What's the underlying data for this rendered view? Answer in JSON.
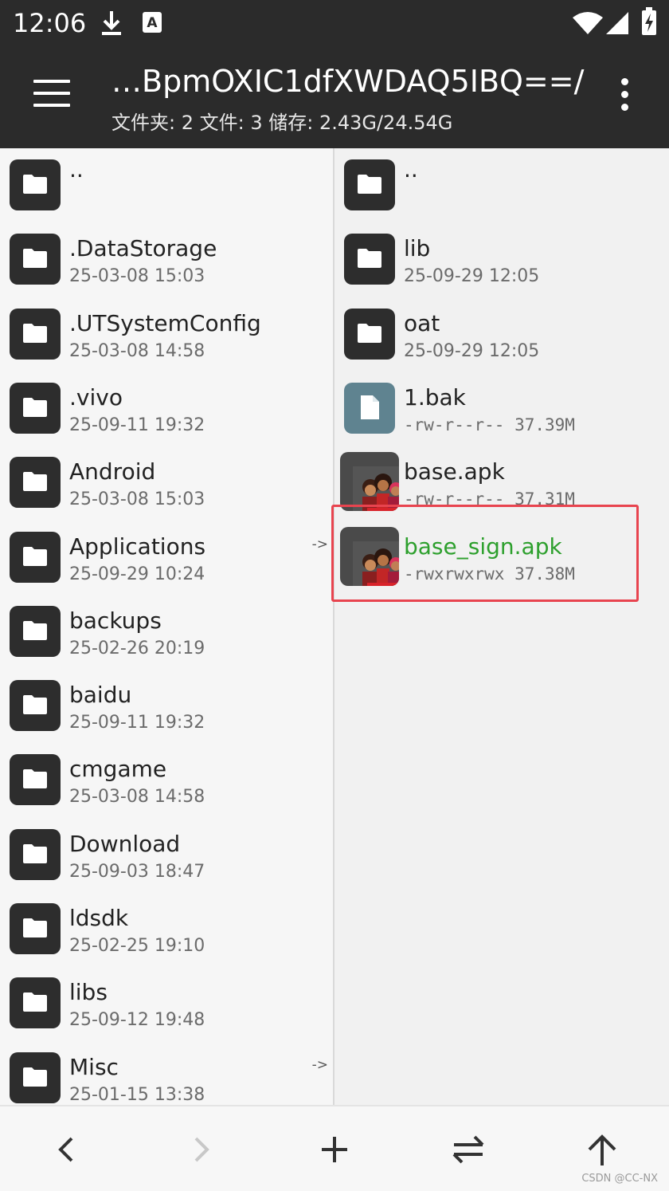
{
  "status_bar": {
    "time": "12:06"
  },
  "toolbar": {
    "title": "…BpmOXIC1dfXWDAQ5IBQ==/",
    "summary": "文件夹: 2  文件: 3  储存: 2.43G/24.54G"
  },
  "left_pane": {
    "items": [
      {
        "name": "..",
        "meta": "",
        "icon": "folder-icon",
        "link": ""
      },
      {
        "name": ".DataStorage",
        "meta": "25-03-08 15:03",
        "icon": "folder-icon",
        "link": ""
      },
      {
        "name": ".UTSystemConfig",
        "meta": "25-03-08 14:58",
        "icon": "folder-icon",
        "link": ""
      },
      {
        "name": ".vivo",
        "meta": "25-09-11 19:32",
        "icon": "folder-icon",
        "link": ""
      },
      {
        "name": "Android",
        "meta": "25-03-08 15:03",
        "icon": "folder-icon",
        "link": ""
      },
      {
        "name": "Applications",
        "meta": "25-09-29 10:24",
        "icon": "folder-icon",
        "link": "->"
      },
      {
        "name": "backups",
        "meta": "25-02-26 20:19",
        "icon": "folder-icon",
        "link": ""
      },
      {
        "name": "baidu",
        "meta": "25-09-11 19:32",
        "icon": "folder-icon",
        "link": ""
      },
      {
        "name": "cmgame",
        "meta": "25-03-08 14:58",
        "icon": "folder-icon",
        "link": ""
      },
      {
        "name": "Download",
        "meta": "25-09-03 18:47",
        "icon": "folder-icon",
        "link": ""
      },
      {
        "name": "ldsdk",
        "meta": "25-02-25 19:10",
        "icon": "folder-icon",
        "link": ""
      },
      {
        "name": "libs",
        "meta": "25-09-12 19:48",
        "icon": "folder-icon",
        "link": ""
      },
      {
        "name": "Misc",
        "meta": "25-01-15 13:38",
        "icon": "folder-icon",
        "link": "->"
      }
    ]
  },
  "right_pane": {
    "items": [
      {
        "name": "..",
        "meta": "",
        "icon": "folder-icon"
      },
      {
        "name": "lib",
        "meta": "25-09-29 12:05",
        "icon": "folder-icon"
      },
      {
        "name": "oat",
        "meta": "25-09-29 12:05",
        "icon": "folder-icon"
      },
      {
        "name": "1.bak",
        "meta": "-rw-r--r--  37.39M",
        "icon": "file-icon"
      },
      {
        "name": "base.apk",
        "meta": "-rw-r--r--  37.31M",
        "icon": "apk-icon"
      },
      {
        "name": "base_sign.apk",
        "meta": "-rwxrwxrwx  37.38M",
        "icon": "apk-icon",
        "color": "#2ea02e"
      }
    ]
  },
  "bottom_bar": {
    "buttons": [
      "back-icon",
      "forward-icon",
      "add-icon",
      "swap-icon",
      "up-icon"
    ]
  },
  "watermark": "CSDN @CC-NX",
  "colors": {
    "bar": "#2b2b2b",
    "highlight": "#e8444f",
    "green": "#2ea02e"
  }
}
